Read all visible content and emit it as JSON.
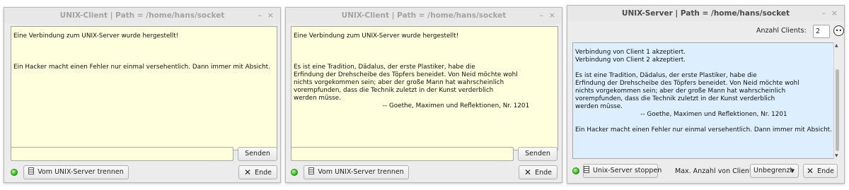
{
  "client1": {
    "title": "UNIX-Client | Path = /home/hans/socket",
    "min_glyph": "–",
    "close_glyph": "×",
    "log": "Eine Verbindung zum UNIX-Server wurde hergestellt!\n\n\n\nEin Hacker macht einen Fehler nur einmal versehentlich. Dann immer mit Absicht.",
    "input_value": "",
    "send_label": "Senden",
    "disconnect_label": "Vom UNIX-Server trennen",
    "end_label": "Ende",
    "status": "connected"
  },
  "client2": {
    "title": "UNIX-Client | Path = /home/hans/socket",
    "min_glyph": "–",
    "close_glyph": "×",
    "log": "Eine Verbindung zum UNIX-Server wurde hergestellt!\n\n\n\nEs ist eine Tradition, Dädalus, der erste Plastiker, habe die\nErfindung der Drehscheibe des Töpfers beneidet. Von Neid möchte wohl\nnichts vorgekommen sein; aber der große Mann hat wahrscheinlich\nvorempfunden, dass die Technik zuletzt in der Kunst verderblich\nwerden müsse.\n                                             -- Goethe, Maximen und Reflektionen, Nr. 1201",
    "input_value": "",
    "send_label": "Senden",
    "disconnect_label": "Vom UNIX-Server trennen",
    "end_label": "Ende",
    "status": "connected"
  },
  "server": {
    "title": "UNIX-Server | Path = /home/hans/socket",
    "min_glyph": "–",
    "close_glyph": "×",
    "clients_label": "Anzahl Clients:",
    "clients_value": "2",
    "log": "Verbindung von Client 1 akzeptiert.\nVerbindung von Client 2 akzeptiert.\n\nEs ist eine Tradition, Dädalus, der erste Plastiker, habe die\nErfindung der Drehscheibe des Töpfers beneidet. Von Neid möchte wohl\nnichts vorgekommen sein; aber der große Mann hat wahrscheinlich\nvorempfunden, dass die Technik zuletzt in der Kunst verderblich\nwerden müsse.\n                                 -- Goethe, Maximen und Reflektionen, Nr. 1201\n\nEin Hacker macht einen Fehler nur einmal versehentlich. Dann immer mit Absicht.",
    "stop_label": "Unix-Server stoppen",
    "max_label": "Max. Anzahl von Clients:",
    "max_value": "Unbegrenzt",
    "end_label": "Ende",
    "status": "running"
  },
  "colors": {
    "client_text_bg": "#ffffdd",
    "server_text_bg": "#ddeeff",
    "status_led": "#2fa820"
  }
}
